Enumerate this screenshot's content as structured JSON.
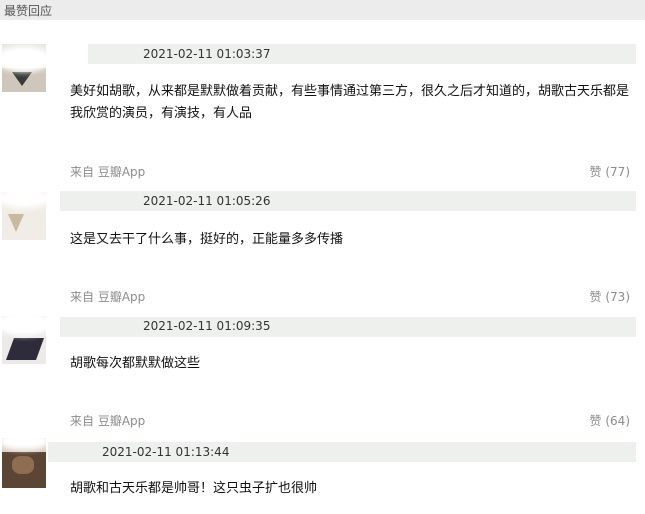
{
  "section": {
    "title": "最赞回应"
  },
  "comments": [
    {
      "timestamp": "2021-02-11 01:03:37",
      "text": "美好如胡歌，从来都是默默做着贡献，有些事情通过第三方，很久之后才知道的，胡歌古天乐都是我欣赏的演员，有演技，有人品",
      "source": "来自 豆瓣App",
      "like": "赞 (77)"
    },
    {
      "timestamp": "2021-02-11 01:05:26",
      "text": "这是又去干了什么事，挺好的，正能量多多传播",
      "source": "来自 豆瓣App",
      "like": "赞 (73)"
    },
    {
      "timestamp": "2021-02-11 01:09:35",
      "text": "胡歌每次都默默做这些",
      "source": "来自 豆瓣App",
      "like": "赞 (64)"
    },
    {
      "timestamp": "2021-02-11 01:13:44",
      "text": "胡歌和古天乐都是帅哥！这只虫子扩也很帅"
    }
  ]
}
